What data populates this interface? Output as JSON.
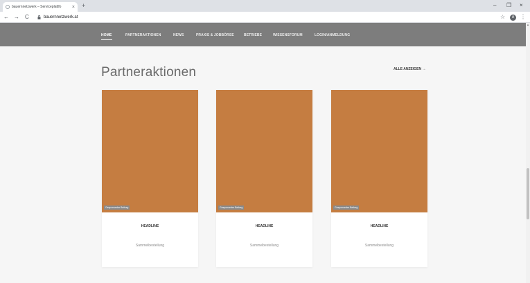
{
  "browser": {
    "tab_title": "bauernnetzwerk – Serviceplattfo",
    "tab_close": "×",
    "new_tab": "+",
    "back": "←",
    "forward": "→",
    "reload": "C",
    "url": "bauernnetzwerk.at",
    "star": "☆",
    "profile_initial": "A",
    "menu": "⋮",
    "minimize": "–",
    "maximize": "❐",
    "close": "×"
  },
  "nav": {
    "items": [
      {
        "label": "HOME",
        "active": true
      },
      {
        "label": "PARTNERAKTIONEN"
      },
      {
        "label": "NEWS"
      },
      {
        "label": "PRAXIS & JOBBÖRSE"
      },
      {
        "label": "BETRIEBE"
      },
      {
        "label": "WISSENSFORUM"
      },
      {
        "label": "LOGIN/ANMELDUNG"
      }
    ]
  },
  "section": {
    "title": "Partneraktionen",
    "show_all": "ALLE ANZEIGEN →"
  },
  "cards": [
    {
      "badge": "Gesponserter Beitrag",
      "headline": "HEADLINE",
      "subtitle": "Sammelbestellung"
    },
    {
      "badge": "Gesponserter Beitrag",
      "headline": "HEADLINE",
      "subtitle": "Sammelbestellung"
    },
    {
      "badge": "Gesponserter Beitrag",
      "headline": "HEADLINE",
      "subtitle": "Sammelbestellung"
    }
  ],
  "colors": {
    "nav_bg": "#7d7d7d",
    "card_image": "#c57d41",
    "page_bg": "#f6f6f6"
  },
  "scrollbar": {
    "up_arrow": "▲"
  }
}
